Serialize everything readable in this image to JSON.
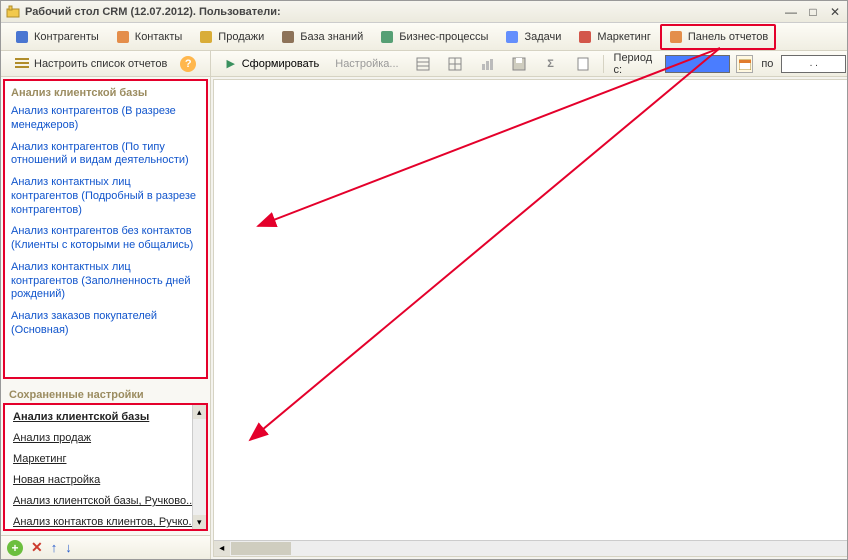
{
  "window": {
    "title": "Рабочий стол CRM (12.07.2012). Пользователи:"
  },
  "main_menu": [
    {
      "id": "contractors",
      "label": "Контрагенты",
      "iconColor": "#2b5fcc"
    },
    {
      "id": "contacts",
      "label": "Контакты",
      "iconColor": "#e07b2e"
    },
    {
      "id": "sales",
      "label": "Продажи",
      "iconColor": "#d4a017"
    },
    {
      "id": "kb",
      "label": "База знаний",
      "iconColor": "#7a5c3e"
    },
    {
      "id": "bp",
      "label": "Бизнес-процессы",
      "iconColor": "#3a915f"
    },
    {
      "id": "tasks",
      "label": "Задачи",
      "iconColor": "#4a7dff"
    },
    {
      "id": "marketing",
      "label": "Маркетинг",
      "iconColor": "#cc3b2e"
    },
    {
      "id": "reports",
      "label": "Панель отчетов",
      "iconColor": "#e07b2e"
    }
  ],
  "left": {
    "config_label": "Настроить список отчетов",
    "section_title": "Анализ клиентской базы",
    "reports": [
      "Анализ контрагентов (В разрезе менеджеров)",
      "Анализ контрагентов (По типу отношений и видам деятельности)",
      "Анализ контактных лиц контрагентов (Подробный в разрезе контрагентов)",
      "Анализ контрагентов без контактов (Клиенты с которыми не общались)",
      "Анализ контактных лиц контрагентов (Заполненность дней рождений)",
      "Анализ заказов покупателей (Основная)"
    ],
    "saved_title": "Сохраненные настройки",
    "saved_items": [
      "Анализ клиентской базы",
      "Анализ продаж",
      "Маркетинг",
      "Новая настройка",
      "Анализ клиентской базы, Ручково...",
      "Анализ контактов клиентов, Ручко..."
    ]
  },
  "right_toolbar": {
    "play_tip": "▶",
    "form_label": "Сформировать",
    "settings_label": "Настройка...",
    "period_label": "Период с:",
    "date_from": "",
    "po": "по",
    "date_to": ". .",
    "dots": "..."
  }
}
